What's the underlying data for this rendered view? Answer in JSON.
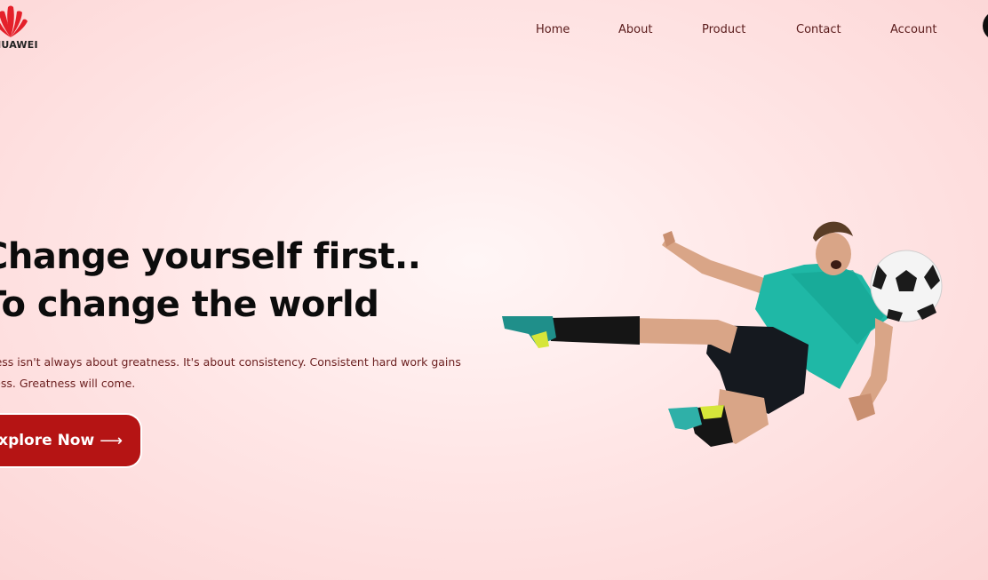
{
  "brand": {
    "logo_text": "HUAWEI",
    "logo_color": "#e4202a"
  },
  "nav": {
    "items": [
      {
        "label": "Home"
      },
      {
        "label": "About"
      },
      {
        "label": "Product"
      },
      {
        "label": "Contact"
      },
      {
        "label": "Account"
      }
    ]
  },
  "hero": {
    "title_line1": "Change yourself first..",
    "title_line2": "To change the world",
    "description": "Success isn't always about greatness. It's about consistency. Consistent hard work gains success. Greatness will come.",
    "cta_label": "Explore Now",
    "cta_arrow_icon": "long-arrow-right-icon",
    "cta_color": "#b51414",
    "image_subject": "soccer player kicking ball"
  },
  "colors": {
    "background": "#ffe6e6",
    "nav_text": "#5a1b1b",
    "heading": "#0c0c0c"
  }
}
